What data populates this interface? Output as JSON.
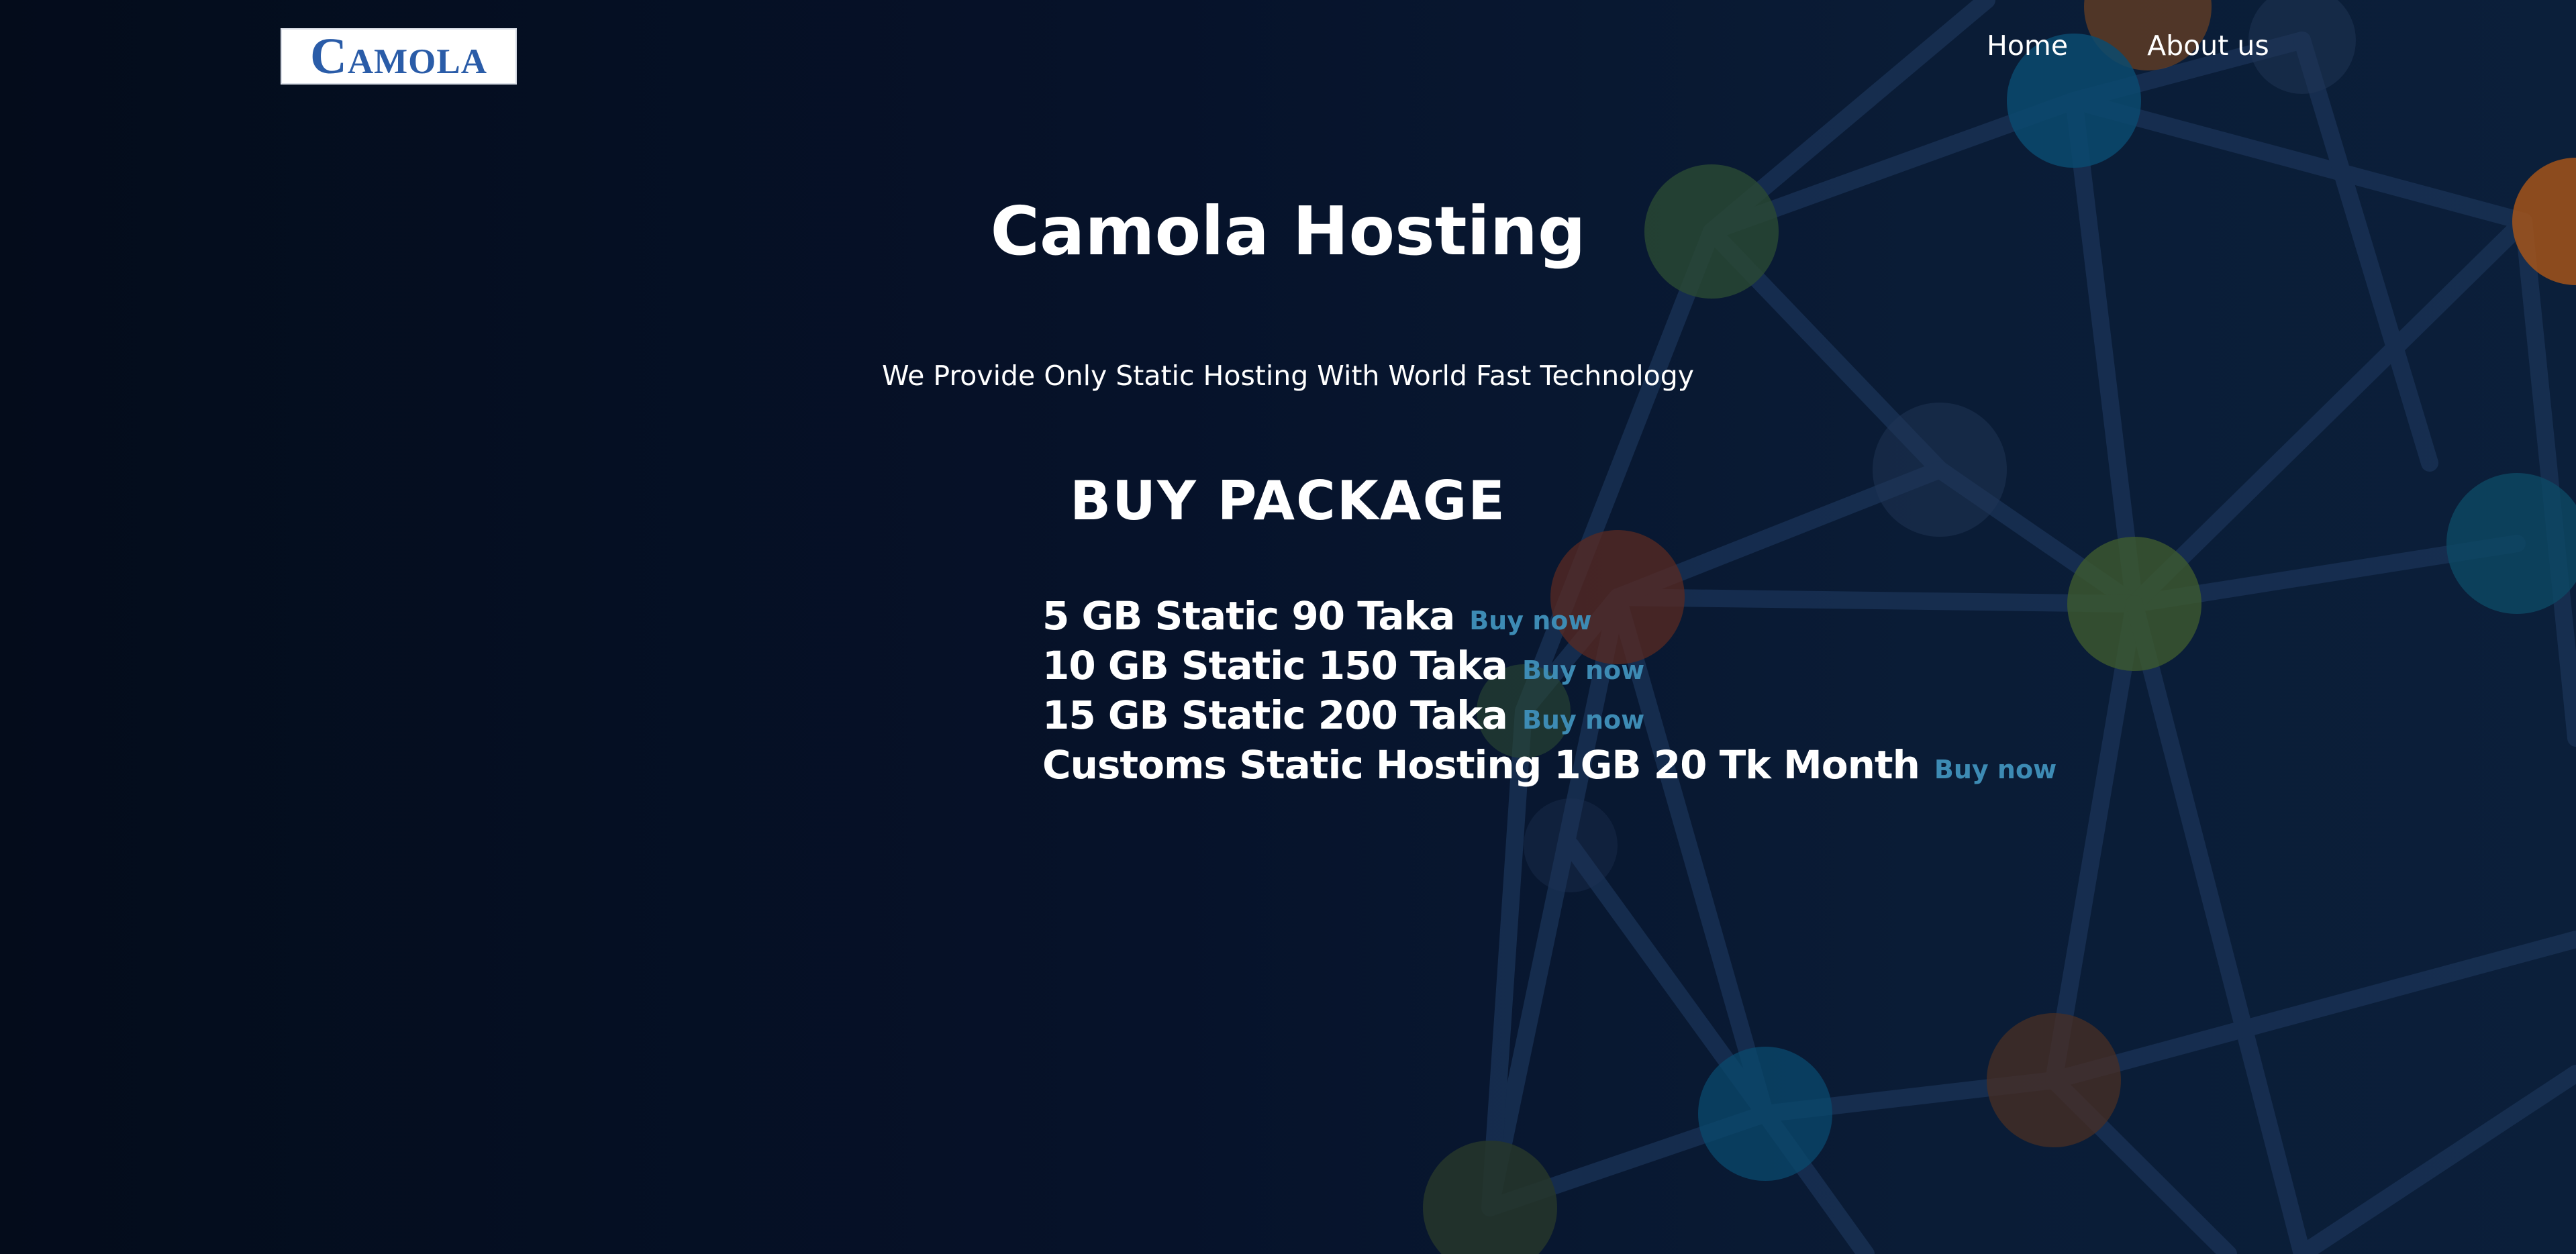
{
  "header": {
    "logo_text": "Camola",
    "nav": [
      {
        "label": "Home"
      },
      {
        "label": "About us"
      }
    ]
  },
  "hero": {
    "title": "Camola Hosting",
    "subtitle": "We Provide Only Static Hosting With World Fast Technology"
  },
  "packages_section": {
    "heading": "BUY PACKAGE",
    "items": [
      {
        "name": "5 GB Static 90 Taka",
        "action": "Buy now"
      },
      {
        "name": "10 GB Static 150 Taka",
        "action": "Buy now"
      },
      {
        "name": "15 GB Static 200 Taka",
        "action": "Buy now"
      },
      {
        "name": "Customs Static Hosting 1GB 20 Tk Month",
        "action": "Buy now"
      }
    ]
  },
  "colors": {
    "background": "#06101f",
    "link": "#3d8bb4",
    "logo_text": "#2a5ca8",
    "text": "#ffffff"
  }
}
